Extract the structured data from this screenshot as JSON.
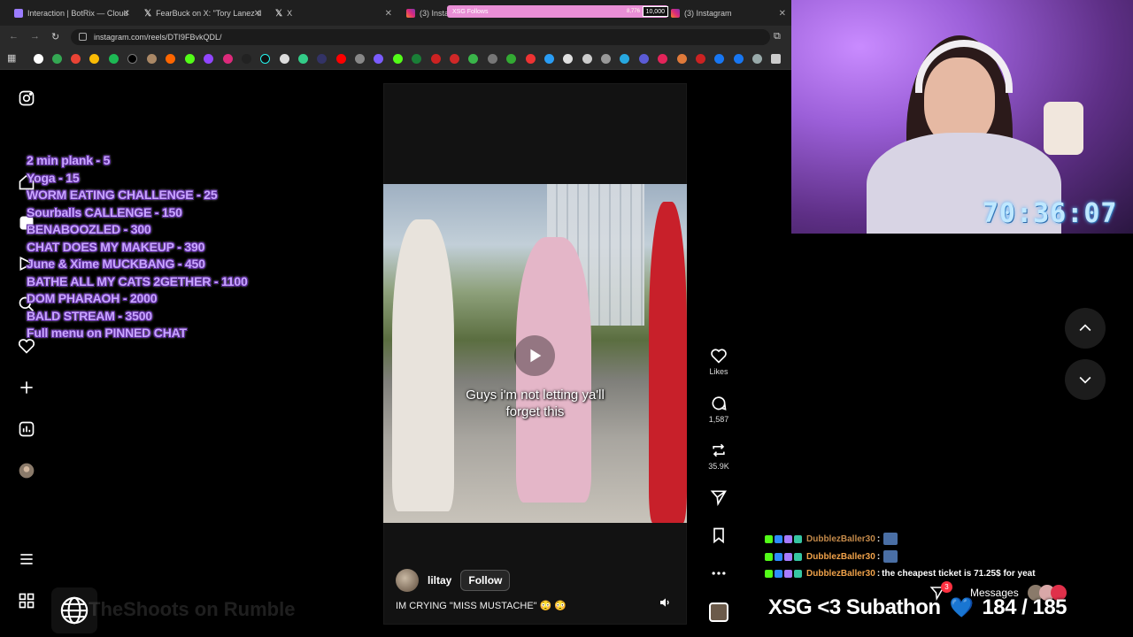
{
  "browser": {
    "tabs": [
      {
        "title": "Interaction | BotRix — Cloud",
        "color": "#9b7cff"
      },
      {
        "title": "FearBuck on X: \"Tory Lanez d",
        "color": "#ffffff"
      },
      {
        "title": "X",
        "color": "#ffffff"
      },
      {
        "title": "(3) Insta",
        "color": "#e1306c"
      },
      {
        "title": "(3) Instagram",
        "color": "#e1306c"
      }
    ],
    "url": "instagram.com/reels/DTI9FBvkQDL/"
  },
  "xsg_follows": {
    "label": "XSG Follows",
    "current": "8,776",
    "goal": "10,000"
  },
  "menu": [
    "2 min plank  -  5",
    "Yoga  -  15",
    "WORM EATING CHALLENGE  -  25",
    "Sourballs CALLENGE  -  150",
    "BENABOOZLED - 300",
    "CHAT DOES MY MAKEUP - 390",
    "June & Xime MUCKBANG - 450",
    "BATHE ALL MY CATS 2GETHER - 1100",
    "DOM PHARAOH - 2000",
    "BALD STREAM - 3500",
    "Full menu on PINNED CHAT"
  ],
  "reel": {
    "overlay_text_1": "Guys i'm not letting ya'll",
    "overlay_text_2": "forget this",
    "author": "liltay",
    "follow_label": "Follow",
    "caption": "IM CRYING \"MISS MUSTACHE\" 😳 😳"
  },
  "actions": {
    "likes_label": "Likes",
    "comments": "1,587",
    "reposts": "35.9K"
  },
  "stream": {
    "timer": "70:36:07",
    "chat": [
      {
        "user": "DubblezBaller30",
        "message": "",
        "emote": true
      },
      {
        "user": "DubblezBaller30",
        "message": "",
        "emote": true
      },
      {
        "user": "DubblezBaller30",
        "message": "the cheapest ticket is 71.25$ for yeat",
        "emote": false
      }
    ],
    "messages_label": "Messages",
    "messages_count": "3",
    "subathon_label": "XSG <3 Subathon",
    "subathon_count": "184 / 185",
    "rumble_watermark": "TheShoots on Rumble"
  },
  "colors": {
    "accent": "#c9a6ff",
    "chat_user": "#f0a24a",
    "instagram_bg": "#000000"
  }
}
